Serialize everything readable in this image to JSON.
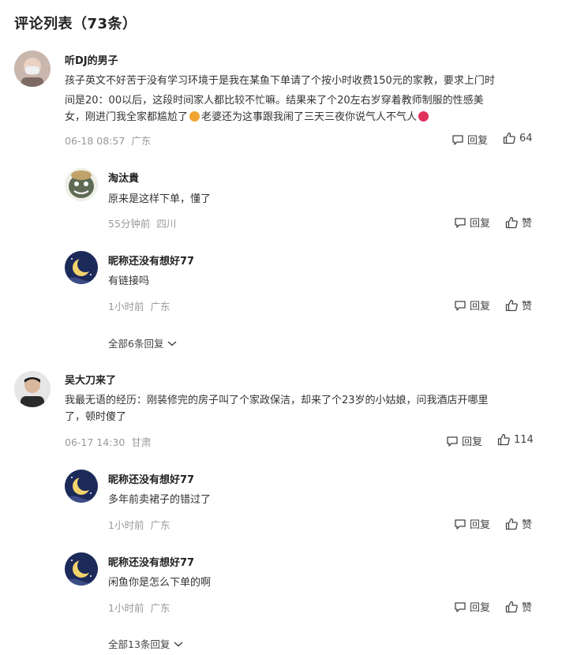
{
  "page": {
    "title": "评论列表（73条）"
  },
  "labels": {
    "reply": "回复",
    "like": "赞"
  },
  "comments": [
    {
      "user": "听DJ的男子",
      "lines": [
        "孩子英文不好苦于没有学习环境于是我在某鱼下单请了个按小时收费150元的家教，要求上门时",
        "间是20：00以后，这段时间家人都比较不忙嘛。结果来了个20左右岁穿着教师制服的性感美",
        "女，刚进门我全家都尴尬了",
        "老婆还为这事跟我闹了三天三夜你说气人不气人"
      ],
      "time": "06-18 08:57",
      "location": "广东",
      "likes": "64",
      "replies": [
        {
          "user": "淘汰貴",
          "text": "原来是这样下单，懂了",
          "time": "55分钟前",
          "location": "四川"
        },
        {
          "user": "昵称还没有想好77",
          "text": "有链接吗",
          "time": "1小时前",
          "location": "广东"
        }
      ],
      "more": "全部6条回复"
    },
    {
      "user": "吴大刀来了",
      "lines": [
        "我最无语的经历：刚装修完的房子叫了个家政保洁，却来了个23岁的小姑娘，问我酒店开哪里",
        "了，顿时傻了"
      ],
      "time": "06-17 14:30",
      "location": "甘肃",
      "likes": "114",
      "replies": [
        {
          "user": "昵称还没有想好77",
          "text": "多年前卖裙子的错过了",
          "time": "1小时前",
          "location": "广东"
        },
        {
          "user": "昵称还没有想好77",
          "text": "闲鱼你是怎么下单的啊",
          "time": "1小时前",
          "location": "广东"
        }
      ],
      "more": "全部13条回复"
    }
  ],
  "colors": {
    "meta": "#999999",
    "text": "#333333",
    "moon_bg": "#1c2a5a",
    "moon": "#f3d36b"
  },
  "icons": {
    "reply": "comment-bubble-icon",
    "like": "thumbs-up-icon",
    "more": "chevron-down-icon"
  }
}
